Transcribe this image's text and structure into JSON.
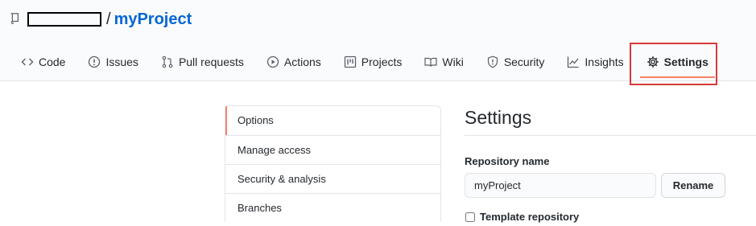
{
  "repo": {
    "owner": "",
    "separator": "/",
    "name": "myProject"
  },
  "tabs": [
    {
      "label": "Code",
      "icon": "code-icon"
    },
    {
      "label": "Issues",
      "icon": "issue-opened-icon"
    },
    {
      "label": "Pull requests",
      "icon": "git-pull-request-icon"
    },
    {
      "label": "Actions",
      "icon": "play-icon"
    },
    {
      "label": "Projects",
      "icon": "project-icon"
    },
    {
      "label": "Wiki",
      "icon": "book-icon"
    },
    {
      "label": "Security",
      "icon": "shield-icon"
    },
    {
      "label": "Insights",
      "icon": "graph-icon"
    },
    {
      "label": "Settings",
      "icon": "gear-icon",
      "selected": true
    }
  ],
  "sidebar": {
    "items": [
      {
        "label": "Options",
        "active": true
      },
      {
        "label": "Manage access"
      },
      {
        "label": "Security & analysis"
      },
      {
        "label": "Branches"
      }
    ]
  },
  "settings": {
    "title": "Settings",
    "repository_name_label": "Repository name",
    "repository_name_value": "myProject",
    "rename_label": "Rename",
    "template_label": "Template repository",
    "template_checked": false
  },
  "colors": {
    "link": "#0366d6",
    "selected_underline": "#f9826c",
    "highlight_box": "#d93a3a",
    "border": "#e1e4e8"
  }
}
